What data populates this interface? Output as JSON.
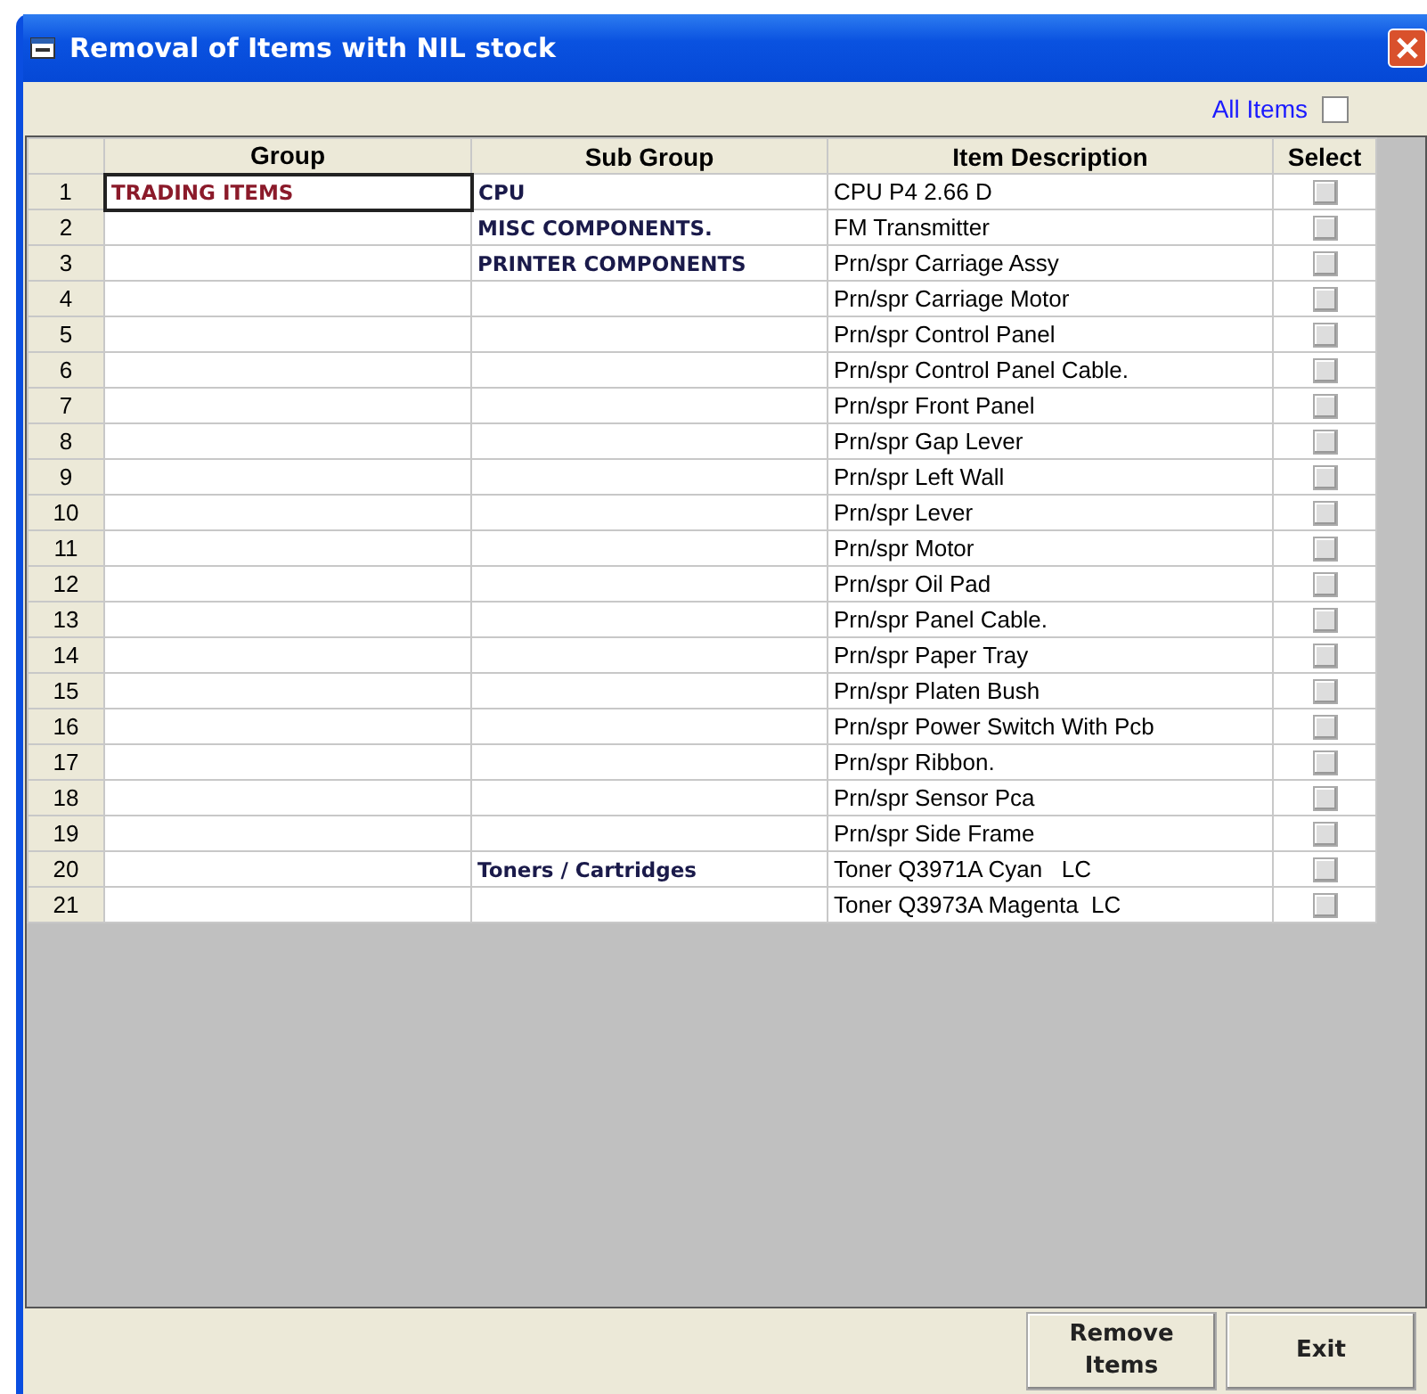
{
  "window": {
    "title": "Removal of Items with NIL stock"
  },
  "all_items": {
    "label": "All Items",
    "checked": false
  },
  "table": {
    "columns": [
      "Group",
      "Sub Group",
      "Item Description",
      "Select"
    ],
    "rows": [
      {
        "num": "1",
        "group": "TRADING ITEMS",
        "sub_group": "CPU",
        "description": "CPU P4 2.66 D",
        "focused": true,
        "checked": false
      },
      {
        "num": "2",
        "group": "",
        "sub_group": "MISC COMPONENTS.",
        "description": "FM Transmitter",
        "focused": false,
        "checked": false
      },
      {
        "num": "3",
        "group": "",
        "sub_group": "PRINTER COMPONENTS",
        "description": "Prn/spr Carriage Assy",
        "focused": false,
        "checked": false
      },
      {
        "num": "4",
        "group": "",
        "sub_group": "",
        "description": "Prn/spr Carriage Motor",
        "focused": false,
        "checked": false
      },
      {
        "num": "5",
        "group": "",
        "sub_group": "",
        "description": "Prn/spr Control Panel",
        "focused": false,
        "checked": false
      },
      {
        "num": "6",
        "group": "",
        "sub_group": "",
        "description": "Prn/spr Control Panel Cable.",
        "focused": false,
        "checked": false
      },
      {
        "num": "7",
        "group": "",
        "sub_group": "",
        "description": "Prn/spr Front Panel",
        "focused": false,
        "checked": false
      },
      {
        "num": "8",
        "group": "",
        "sub_group": "",
        "description": "Prn/spr Gap Lever",
        "focused": false,
        "checked": false
      },
      {
        "num": "9",
        "group": "",
        "sub_group": "",
        "description": "Prn/spr Left Wall",
        "focused": false,
        "checked": false
      },
      {
        "num": "10",
        "group": "",
        "sub_group": "",
        "description": "Prn/spr Lever",
        "focused": false,
        "checked": false
      },
      {
        "num": "11",
        "group": "",
        "sub_group": "",
        "description": "Prn/spr Motor",
        "focused": false,
        "checked": false
      },
      {
        "num": "12",
        "group": "",
        "sub_group": "",
        "description": "Prn/spr Oil Pad",
        "focused": false,
        "checked": false
      },
      {
        "num": "13",
        "group": "",
        "sub_group": "",
        "description": "Prn/spr Panel Cable.",
        "focused": false,
        "checked": false
      },
      {
        "num": "14",
        "group": "",
        "sub_group": "",
        "description": "Prn/spr Paper Tray",
        "focused": false,
        "checked": false
      },
      {
        "num": "15",
        "group": "",
        "sub_group": "",
        "description": "Prn/spr Platen Bush",
        "focused": false,
        "checked": false
      },
      {
        "num": "16",
        "group": "",
        "sub_group": "",
        "description": "Prn/spr Power Switch With Pcb",
        "focused": false,
        "checked": false
      },
      {
        "num": "17",
        "group": "",
        "sub_group": "",
        "description": "Prn/spr Ribbon.",
        "focused": false,
        "checked": false
      },
      {
        "num": "18",
        "group": "",
        "sub_group": "",
        "description": "Prn/spr Sensor Pca",
        "focused": false,
        "checked": false
      },
      {
        "num": "19",
        "group": "",
        "sub_group": "",
        "description": "Prn/spr Side Frame",
        "focused": false,
        "checked": false
      },
      {
        "num": "20",
        "group": "",
        "sub_group": "Toners / Cartridges",
        "description": "Toner Q3971A Cyan   LC",
        "focused": false,
        "checked": false
      },
      {
        "num": "21",
        "group": "",
        "sub_group": "",
        "description": "Toner Q3973A Magenta  LC",
        "focused": false,
        "checked": false
      }
    ]
  },
  "buttons": [
    "Remove Items",
    "Exit"
  ]
}
